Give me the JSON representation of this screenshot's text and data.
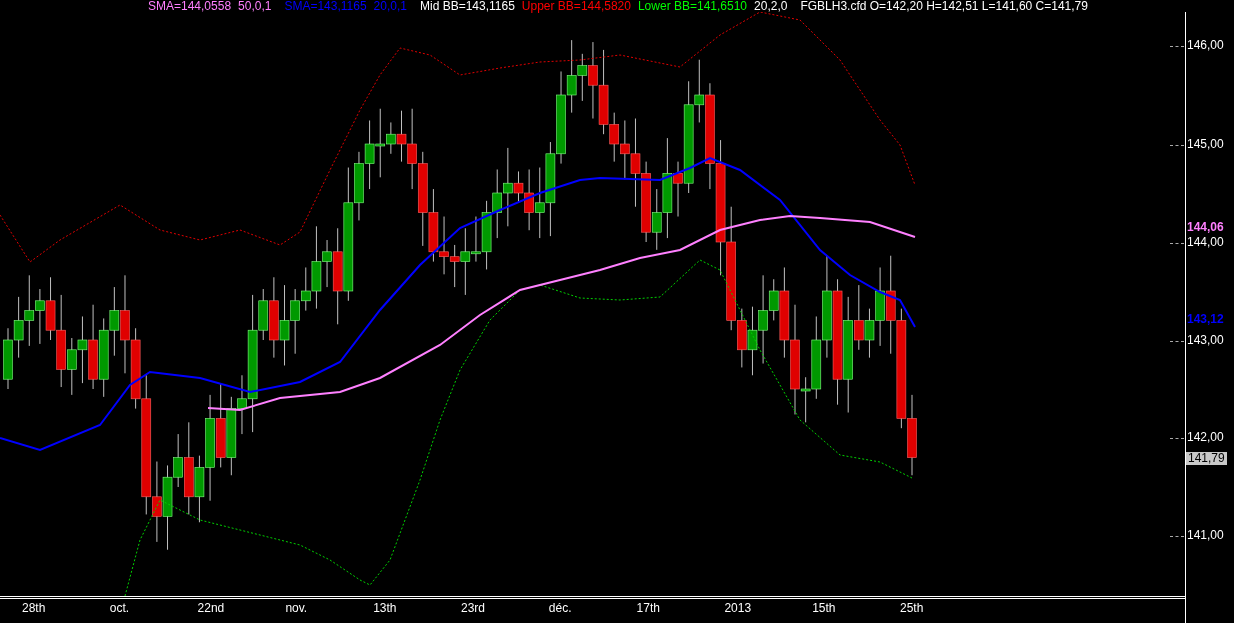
{
  "legend": [
    {
      "text": "SMA=144,0558",
      "color": "#ff80ff"
    },
    {
      "text": "50,0,1",
      "color": "#ff80ff"
    },
    {
      "text": "SMA=143,1165",
      "color": "#0000ff"
    },
    {
      "text": "20,0,1",
      "color": "#0000ff"
    },
    {
      "text": "Mid BB=143,1165",
      "color": "#ffffff"
    },
    {
      "text": "Upper BB=144,5820",
      "color": "#ff0000"
    },
    {
      "text": "Lower BB=141,6510",
      "color": "#00ff00"
    },
    {
      "text": "20,2,0",
      "color": "#ffffff"
    },
    {
      "text": "FGBLH3.cfd O=142,20 H=142,51 L=141,60 C=141,79",
      "color": "#ffffff"
    }
  ],
  "price_axis": {
    "ticks": [
      "146,00",
      "145,00",
      "144,00",
      "143,00",
      "142,00",
      "141,00"
    ],
    "markers": [
      {
        "text": "144,06",
        "kind": "indicator",
        "color": "#ff80ff"
      },
      {
        "text": "143,12",
        "kind": "indicator",
        "color": "#0000ff"
      },
      {
        "text": "141,79",
        "kind": "last",
        "color": "#c8c8c8"
      }
    ]
  },
  "time_axis": {
    "labels": [
      "28th",
      "oct.",
      "22nd",
      "nov.",
      "13th",
      "23rd",
      "déc.",
      "17th",
      "2013",
      "15th",
      "25th"
    ]
  }
}
